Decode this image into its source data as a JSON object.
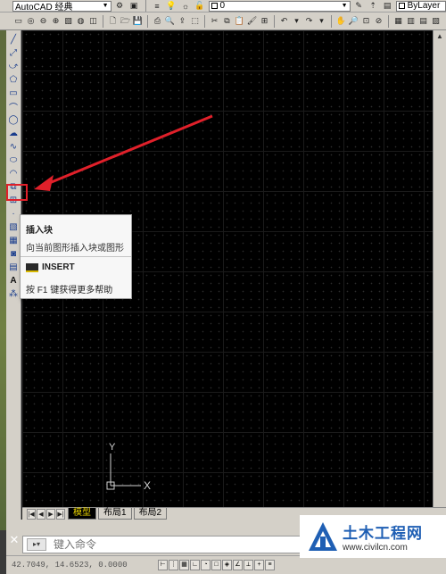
{
  "toolbar": {
    "workspace_select": "AutoCAD 经典",
    "layer_select": "0",
    "color_select": "ByLayer"
  },
  "tooltip": {
    "title": "插入块",
    "description": "向当前图形插入块或图形",
    "command_name": "INSERT",
    "help_text": "按 F1 键获得更多帮助"
  },
  "ucs": {
    "x_label": "X",
    "y_label": "Y"
  },
  "layout_tabs": [
    {
      "label": "模型",
      "active": true
    },
    {
      "label": "布局1",
      "active": false
    },
    {
      "label": "布局2",
      "active": false
    }
  ],
  "command_line": {
    "placeholder": "键入命令"
  },
  "status_bar": {
    "coordinates": "42.7049, 14.6523, 0.0000"
  },
  "watermark": {
    "title": "土木工程网",
    "url": "www.civilcn.com"
  },
  "colors": {
    "canvas_bg": "#000000",
    "highlight_red": "#e0202a",
    "active_tab_text": "#e8d200",
    "watermark_blue": "#1f5fb4"
  }
}
